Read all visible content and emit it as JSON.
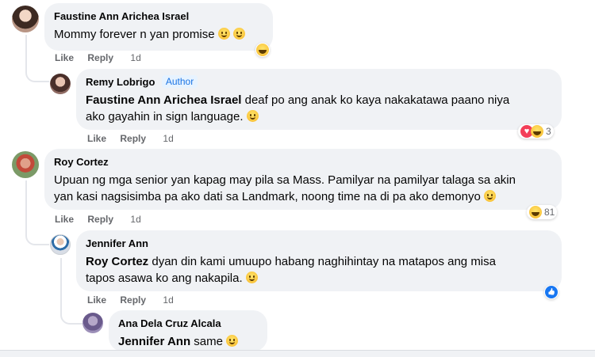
{
  "actions": {
    "like": "Like",
    "reply": "Reply"
  },
  "comments": [
    {
      "author": "Faustine Ann Arichea Israel",
      "text": "Mommy forever n yan promise",
      "time": "1d",
      "avatar_color": "#c9a38c"
    },
    {
      "author": "Remy Lobrigo",
      "badge": "Author",
      "mention": "Faustine Ann Arichea Israel",
      "text_line1": "deaf po ang anak ko kaya nakakatawa paano niya",
      "text_line2": "ako gayahin in sign language.",
      "time": "1d",
      "reaction_count": "3",
      "avatar_color": "#7a5c58"
    },
    {
      "author": "Roy Cortez",
      "text_line1": "Upuan ng mga senior yan kapag may pila sa Mass. Pamilyar na pamilyar talaga sa akin",
      "text_line2": "yan kasi nagsisimba pa ako dati sa Landmark, noong time na di pa ako demonyo",
      "time": "1d",
      "reaction_count": "81",
      "avatar_color": "#6c8f5a"
    },
    {
      "author": "Jennifer Ann",
      "mention": "Roy Cortez",
      "text_line1": "dyan din kami umuupo habang naghihintay na matapos ang misa",
      "text_line2": "tapos asawa ko ang nakapila.",
      "time": "1d",
      "avatar_color": "#d8dde6"
    },
    {
      "author": "Ana Dela Cruz Alcala",
      "mention": "Jennifer Ann",
      "text": "same",
      "avatar_color": "#8a7aa8"
    }
  ],
  "colors": {
    "bubble": "#f0f2f5",
    "meta": "#65676b",
    "badge": "#1b74e4"
  }
}
